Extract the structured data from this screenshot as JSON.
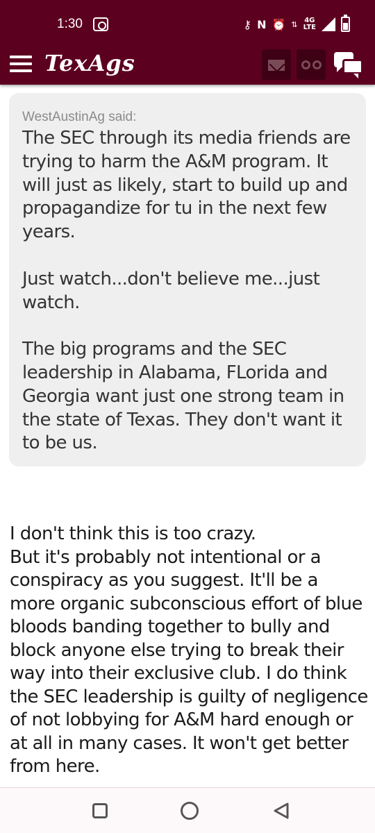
{
  "status_bar": {
    "time": "1:30",
    "network": "4G\nLTE",
    "icons": [
      "cast-icon",
      "key-icon",
      "nfc-icon",
      "alarm-icon",
      "data-arrows-icon",
      "signal-icon",
      "battery-icon"
    ]
  },
  "header": {
    "logo": "TexAgs",
    "icons": [
      "menu-icon",
      "mail-icon",
      "binoculars-icon",
      "chat-icon"
    ],
    "colors": {
      "bar": "#5c0020",
      "button": "#3e0015"
    }
  },
  "quote": {
    "author": "WestAustinAg said:",
    "paragraphs": [
      "The SEC through its media friends are trying to harm the A&M program. It will just as likely, start to build up and propagandize for tu in the next few years.",
      "Just watch...don't believe me...just watch.",
      "The big programs and the SEC leadership in Alabama, FLorida and Georgia want just one strong team in the state of Texas. They don't want it to be us."
    ]
  },
  "reply": {
    "lines": [
      "I don't think this is too crazy.",
      "But it's probably not intentional or a conspiracy as you suggest. It'll be a more organic subconscious effort of blue bloods banding together to bully and block anyone else trying to break their way into their exclusive club. I do think the SEC leadership is guilty of negligence of not lobbying for A&M hard enough or at all in many cases. It won't get better from here."
    ]
  },
  "nav": {
    "buttons": [
      "recents-button",
      "home-button",
      "back-button"
    ]
  }
}
